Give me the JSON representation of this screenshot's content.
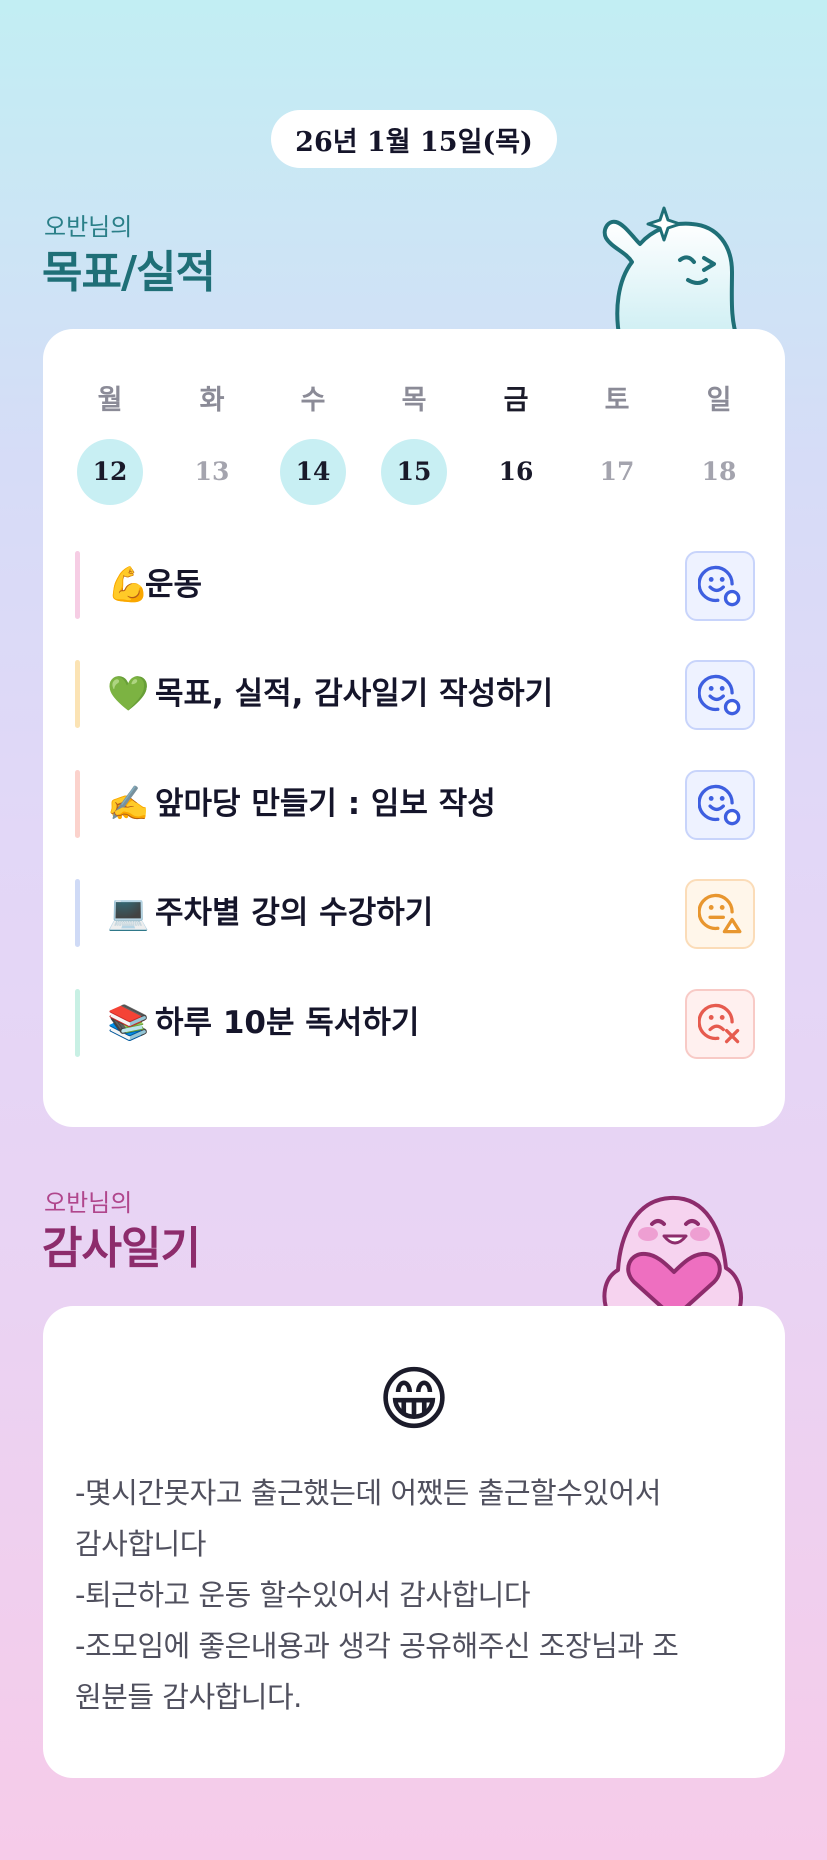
{
  "date": "26년 1월 15일(목)",
  "goals_section": {
    "subtitle": "오반님의",
    "title": "목표/실적"
  },
  "week": {
    "days": [
      {
        "label": "월",
        "num": "12",
        "done": true,
        "today": false
      },
      {
        "label": "화",
        "num": "13",
        "done": false,
        "today": false
      },
      {
        "label": "수",
        "num": "14",
        "done": true,
        "today": false
      },
      {
        "label": "목",
        "num": "15",
        "done": true,
        "today": false
      },
      {
        "label": "금",
        "num": "16",
        "done": false,
        "today": true
      },
      {
        "label": "토",
        "num": "17",
        "done": false,
        "today": false
      },
      {
        "label": "일",
        "num": "18",
        "done": false,
        "today": false
      }
    ]
  },
  "goals": [
    {
      "emoji": "💪",
      "text": "운동",
      "bar_color": "#f6cde4",
      "status": "good",
      "status_icon": "smile-check-icon"
    },
    {
      "emoji": "💚",
      "text": "목표, 실적, 감사일기 작성하기",
      "bar_color": "#fbe3b4",
      "status": "good",
      "status_icon": "smile-check-icon"
    },
    {
      "emoji": "✍️",
      "text": "앞마당 만들기 : 임보 작성",
      "bar_color": "#fbd2cc",
      "status": "good",
      "status_icon": "smile-check-icon"
    },
    {
      "emoji": "💻",
      "text": "주차별 강의 수강하기",
      "bar_color": "#cfdaf6",
      "status": "mid",
      "status_icon": "neutral-triangle-icon"
    },
    {
      "emoji": "📚",
      "text": "하루 10분 독서하기",
      "bar_color": "#c8f0e4",
      "status": "bad",
      "status_icon": "sad-x-icon"
    }
  ],
  "status_colors": {
    "good": "#3e5fe0",
    "mid": "#e8962f",
    "bad": "#e65b4f"
  },
  "gratitude_section": {
    "subtitle": "오반님의",
    "title": "감사일기"
  },
  "gratitude": {
    "emoji": "😁",
    "lines": [
      "-몇시간못자고 출근했는데 어쨌든 출근할수있어서",
      "감사합니다",
      "-퇴근하고 운동 할수있어서 감사합니다",
      "-조모임에 좋은내용과 생각 공유해주신 조장님과 조",
      "원분들 감사합니다."
    ]
  }
}
